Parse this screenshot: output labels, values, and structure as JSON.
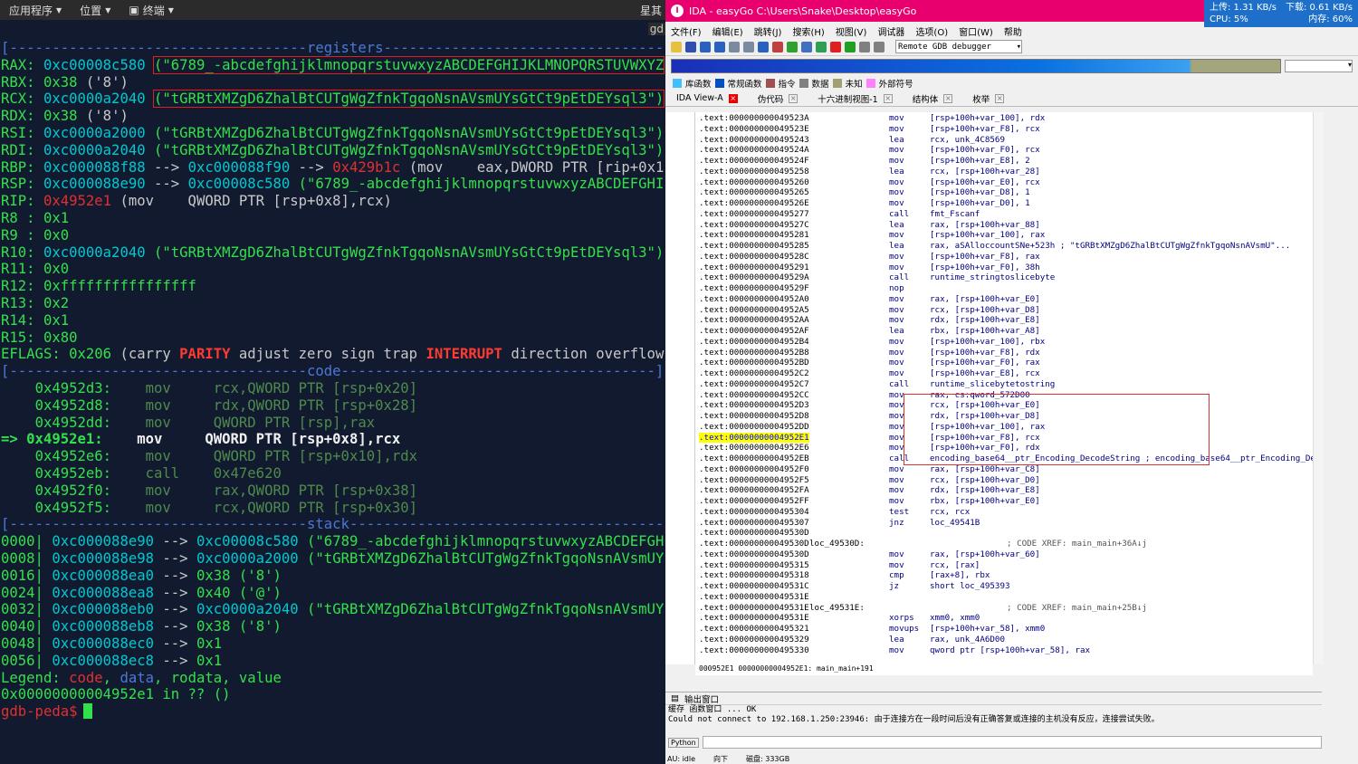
{
  "topbar": {
    "apps": "应用程序",
    "places": "位置",
    "terminal": "终端",
    "right": "星其"
  },
  "terminal": {
    "tab_cut": "gd",
    "sections": {
      "registers": "registers",
      "code": "code",
      "stack": "stack"
    },
    "registers": [
      {
        "name": "RAX:",
        "addr": "0xc00008c580",
        "val": "(\"6789_-abcdefghijklmnopqrstuvwxyzABCDEFGHIJKLMNOPQRSTUVWXYZ"
      },
      {
        "name": "RBX:",
        "addr": "0x38",
        "val": "('8')"
      },
      {
        "name": "RCX:",
        "addr": "0xc0000a2040",
        "val": "(\"tGRBtXMZgD6ZhalBtCUTgWgZfnkTgqoNsnAVsmUYsGtCt9pEtDEYsql3\")"
      },
      {
        "name": "RDX:",
        "addr": "0x38",
        "val": "('8')"
      },
      {
        "name": "RSI:",
        "addr": "0xc0000a2000",
        "val": "(\"tGRBtXMZgD6ZhalBtCUTgWgZfnkTgqoNsnAVsmUYsGtCt9pEtDEYsql3\")"
      },
      {
        "name": "RDI:",
        "addr": "0xc0000a2040",
        "val": "(\"tGRBtXMZgD6ZhalBtCUTgWgZfnkTgqoNsnAVsmUYsGtCt9pEtDEYsql3\")"
      },
      {
        "name": "RBP:",
        "addr": "0xc000088f88",
        "arrow1": "-->",
        "addr2": "0xc000088f90",
        "arrow2": "-->",
        "addr3": "0x429b1c",
        "val": "(mov    eax,DWORD PTR [rip+0x1"
      },
      {
        "name": "RSP:",
        "addr": "0xc000088e90",
        "arrow1": "-->",
        "addr2": "0xc00008c580",
        "val": "(\"6789_-abcdefghijklmnopqrstuvwxyzABCDEFGHI"
      },
      {
        "name": "RIP:",
        "addr": "0x4952e1",
        "val": "(mov    QWORD PTR [rsp+0x8],rcx)"
      },
      {
        "name": "R8 :",
        "addr": "0x1"
      },
      {
        "name": "R9 :",
        "addr": "0x0"
      },
      {
        "name": "R10:",
        "addr": "0xc0000a2040",
        "val": "(\"tGRBtXMZgD6ZhalBtCUTgWgZfnkTgqoNsnAVsmUYsGtCt9pEtDEYsql3\")"
      },
      {
        "name": "R11:",
        "addr": "0x0"
      },
      {
        "name": "R12:",
        "addr": "0xffffffffffffffff"
      },
      {
        "name": "R13:",
        "addr": "0x2"
      },
      {
        "name": "R14:",
        "addr": "0x1"
      },
      {
        "name": "R15:",
        "addr": "0x80"
      }
    ],
    "eflags": {
      "label": "EFLAGS:",
      "value": "0x206",
      "open": "(carry",
      "parity": "PARITY",
      "mid": "adjust zero sign trap",
      "interrupt": "INTERRUPT",
      "tail": "direction overflow"
    },
    "code": [
      {
        "marker": "",
        "addr": "0x4952d3:",
        "mn": "mov",
        "op": "rcx,QWORD PTR [rsp+0x20]"
      },
      {
        "marker": "",
        "addr": "0x4952d8:",
        "mn": "mov",
        "op": "rdx,QWORD PTR [rsp+0x28]"
      },
      {
        "marker": "",
        "addr": "0x4952dd:",
        "mn": "mov",
        "op": "QWORD PTR [rsp],rax"
      },
      {
        "marker": "=>",
        "addr": "0x4952e1:",
        "mn": "mov",
        "op": "QWORD PTR [rsp+0x8],rcx"
      },
      {
        "marker": "",
        "addr": "0x4952e6:",
        "mn": "mov",
        "op": "QWORD PTR [rsp+0x10],rdx"
      },
      {
        "marker": "",
        "addr": "0x4952eb:",
        "mn": "call",
        "op": "0x47e620"
      },
      {
        "marker": "",
        "addr": "0x4952f0:",
        "mn": "mov",
        "op": "rax,QWORD PTR [rsp+0x38]"
      },
      {
        "marker": "",
        "addr": "0x4952f5:",
        "mn": "mov",
        "op": "rcx,QWORD PTR [rsp+0x30]"
      }
    ],
    "stack": [
      {
        "off": "0000|",
        "addr": "0xc000088e90",
        "arrow": "-->",
        "val": "0xc00008c580",
        "str": "(\"6789_-abcdefghijklmnopqrstuvwxyzABCDEFGH"
      },
      {
        "off": "0008|",
        "addr": "0xc000088e98",
        "arrow": "-->",
        "val": "0xc0000a2000",
        "str": "(\"tGRBtXMZgD6ZhalBtCUTgWgZfnkTgqoNsnAVsmUY"
      },
      {
        "off": "0016|",
        "addr": "0xc000088ea0",
        "arrow": "-->",
        "val": "0x38",
        "str": "('8')"
      },
      {
        "off": "0024|",
        "addr": "0xc000088ea8",
        "arrow": "-->",
        "val": "0x40",
        "str": "('@')"
      },
      {
        "off": "0032|",
        "addr": "0xc000088eb0",
        "arrow": "-->",
        "val": "0xc0000a2040",
        "str": "(\"tGRBtXMZgD6ZhalBtCUTgWgZfnkTgqoNsnAVsmUY"
      },
      {
        "off": "0040|",
        "addr": "0xc000088eb8",
        "arrow": "-->",
        "val": "0x38",
        "str": "('8')"
      },
      {
        "off": "0048|",
        "addr": "0xc000088ec0",
        "arrow": "-->",
        "val": "0x1",
        "str": ""
      },
      {
        "off": "0056|",
        "addr": "0xc000088ec8",
        "arrow": "-->",
        "val": "0x1",
        "str": ""
      }
    ],
    "legend": {
      "label": "Legend:",
      "code": "code",
      "data": "data",
      "rodata": "rodata",
      "value": "value"
    },
    "location": "0x00000000004952e1 in ?? ()",
    "prompt": "gdb-peda$"
  },
  "ida": {
    "title": "IDA - easyGo C:\\Users\\Snake\\Desktop\\easyGo",
    "net": {
      "up": "上传: 1.31 KB/s",
      "down": "下载: 0.61 KB/s",
      "cpu": "CPU: 5%",
      "mem": "内存: 60%"
    },
    "menu": [
      "文件(F)",
      "编辑(E)",
      "跳转(J)",
      "搜索(H)",
      "视图(V)",
      "调试器",
      "选项(O)",
      "窗口(W)",
      "帮助"
    ],
    "debugger": "Remote GDB debugger",
    "legend": [
      "库函数",
      "常规函数",
      "指令",
      "数据",
      "未知",
      "外部符号"
    ],
    "legend_colors": [
      "#40c0ff",
      "#0050c0",
      "#a05050",
      "#808080",
      "#a0a070",
      "#ff80ff"
    ],
    "tabs": [
      "IDA View-A",
      "伪代码",
      "十六进制视图-1",
      "结构体",
      "枚举"
    ],
    "lines": [
      {
        "a": ".text:000000000049523A",
        "m": "mov",
        "o": "[rsp+100h+var_100], rdx"
      },
      {
        "a": ".text:000000000049523E",
        "m": "mov",
        "o": "[rsp+100h+var_F8], rcx"
      },
      {
        "a": ".text:0000000000495243",
        "m": "lea",
        "o": "rcx, unk_4C8569"
      },
      {
        "a": ".text:000000000049524A",
        "m": "mov",
        "o": "[rsp+100h+var_F0], rcx"
      },
      {
        "a": ".text:000000000049524F",
        "m": "mov",
        "o": "[rsp+100h+var_E8], 2"
      },
      {
        "a": ".text:0000000000495258",
        "m": "lea",
        "o": "rcx, [rsp+100h+var_28]"
      },
      {
        "a": ".text:0000000000495260",
        "m": "mov",
        "o": "[rsp+100h+var_E0], rcx"
      },
      {
        "a": ".text:0000000000495265",
        "m": "mov",
        "o": "[rsp+100h+var_D8], 1"
      },
      {
        "a": ".text:000000000049526E",
        "m": "mov",
        "o": "[rsp+100h+var_D0], 1"
      },
      {
        "a": ".text:0000000000495277",
        "m": "call",
        "o": "fmt_Fscanf"
      },
      {
        "a": ".text:000000000049527C",
        "m": "lea",
        "o": "rax, [rsp+100h+var_88]"
      },
      {
        "a": ".text:0000000000495281",
        "m": "mov",
        "o": "[rsp+100h+var_100], rax"
      },
      {
        "a": ".text:0000000000495285",
        "m": "lea",
        "o": "rax, aSAlloccountSNe+523h ; \"tGRBtXMZgD6ZhalBtCUTgWgZfnkTgqoNsnAVsmU\"..."
      },
      {
        "a": ".text:000000000049528C",
        "m": "mov",
        "o": "[rsp+100h+var_F8], rax"
      },
      {
        "a": ".text:0000000000495291",
        "m": "mov",
        "o": "[rsp+100h+var_F0], 38h"
      },
      {
        "a": ".text:000000000049529A",
        "m": "call",
        "o": "runtime_stringtoslicebyte"
      },
      {
        "a": ".text:000000000049529F",
        "m": "nop",
        "o": ""
      },
      {
        "a": ".text:00000000004952A0",
        "m": "mov",
        "o": "rax, [rsp+100h+var_E0]"
      },
      {
        "a": ".text:00000000004952A5",
        "m": "mov",
        "o": "rcx, [rsp+100h+var_D8]"
      },
      {
        "a": ".text:00000000004952AA",
        "m": "mov",
        "o": "rdx, [rsp+100h+var_E8]"
      },
      {
        "a": ".text:00000000004952AF",
        "m": "lea",
        "o": "rbx, [rsp+100h+var_A8]"
      },
      {
        "a": ".text:00000000004952B4",
        "m": "mov",
        "o": "[rsp+100h+var_100], rbx"
      },
      {
        "a": ".text:00000000004952B8",
        "m": "mov",
        "o": "[rsp+100h+var_F8], rdx"
      },
      {
        "a": ".text:00000000004952BD",
        "m": "mov",
        "o": "[rsp+100h+var_F0], rax"
      },
      {
        "a": ".text:00000000004952C2",
        "m": "mov",
        "o": "[rsp+100h+var_E8], rcx"
      },
      {
        "a": ".text:00000000004952C7",
        "m": "call",
        "o": "runtime_slicebytetostring"
      },
      {
        "a": ".text:00000000004952CC",
        "m": "mov",
        "o": "rax, cs:qword_572D00"
      },
      {
        "a": ".text:00000000004952D3",
        "m": "mov",
        "o": "rcx, [rsp+100h+var_E0]"
      },
      {
        "a": ".text:00000000004952D8",
        "m": "mov",
        "o": "rdx, [rsp+100h+var_D8]"
      },
      {
        "a": ".text:00000000004952DD",
        "m": "mov",
        "o": "[rsp+100h+var_100], rax"
      },
      {
        "a": ".text:00000000004952E1",
        "m": "mov",
        "o": "[rsp+100h+var_F8], rcx",
        "hl": true
      },
      {
        "a": ".text:00000000004952E6",
        "m": "mov",
        "o": "[rsp+100h+var_F0], rdx"
      },
      {
        "a": ".text:00000000004952EB",
        "m": "call",
        "o": "encoding_base64__ptr_Encoding_DecodeString ; encoding_base64__ptr_Encoding_De"
      },
      {
        "a": ".text:00000000004952F0",
        "m": "mov",
        "o": "rax, [rsp+100h+var_C8]"
      },
      {
        "a": ".text:00000000004952F5",
        "m": "mov",
        "o": "rcx, [rsp+100h+var_D0]"
      },
      {
        "a": ".text:00000000004952FA",
        "m": "mov",
        "o": "rdx, [rsp+100h+var_E8]"
      },
      {
        "a": ".text:00000000004952FF",
        "m": "mov",
        "o": "rbx, [rsp+100h+var_E0]"
      },
      {
        "a": ".text:0000000000495304",
        "m": "test",
        "o": "rcx, rcx"
      },
      {
        "a": ".text:0000000000495307",
        "m": "jnz",
        "o": "loc_49541B"
      },
      {
        "a": ".text:000000000049530D",
        "m": "",
        "o": ""
      },
      {
        "a": ".text:000000000049530D",
        "l": "loc_49530D:",
        "m": "",
        "o": "",
        "c": "; CODE XREF: main_main+36A↓j"
      },
      {
        "a": ".text:000000000049530D",
        "m": "mov",
        "o": "rax, [rsp+100h+var_60]"
      },
      {
        "a": ".text:0000000000495315",
        "m": "mov",
        "o": "rcx, [rax]"
      },
      {
        "a": ".text:0000000000495318",
        "m": "cmp",
        "o": "[rax+8], rbx"
      },
      {
        "a": ".text:000000000049531C",
        "m": "jz",
        "o": "short loc_495393"
      },
      {
        "a": ".text:000000000049531E",
        "m": "",
        "o": ""
      },
      {
        "a": ".text:000000000049531E",
        "l": "loc_49531E:",
        "m": "",
        "o": "",
        "c": "; CODE XREF: main_main+25B↓j"
      },
      {
        "a": ".text:000000000049531E",
        "m": "xorps",
        "o": "xmm0, xmm0"
      },
      {
        "a": ".text:0000000000495321",
        "m": "movups",
        "o": "[rsp+100h+var_58], xmm0"
      },
      {
        "a": ".text:0000000000495329",
        "m": "lea",
        "o": "rax, unk_4A6D00"
      },
      {
        "a": ".text:0000000000495330",
        "m": "mov",
        "o": "qword ptr [rsp+100h+var_58], rax"
      }
    ],
    "status_line": "000952E1  00000000004952E1: main_main+191",
    "output": {
      "title": "输出窗口",
      "line1": "缓存  函数窗口     ... OK",
      "line2": "Could not connect to 192.168.1.250:23946: 由于连接方在一段时间后没有正确答复或连接的主机没有反应，连接尝试失败。",
      "python": "Python",
      "state": "AU:  idle",
      "dir": "向下",
      "disk": "磁盘: 333GB"
    }
  }
}
